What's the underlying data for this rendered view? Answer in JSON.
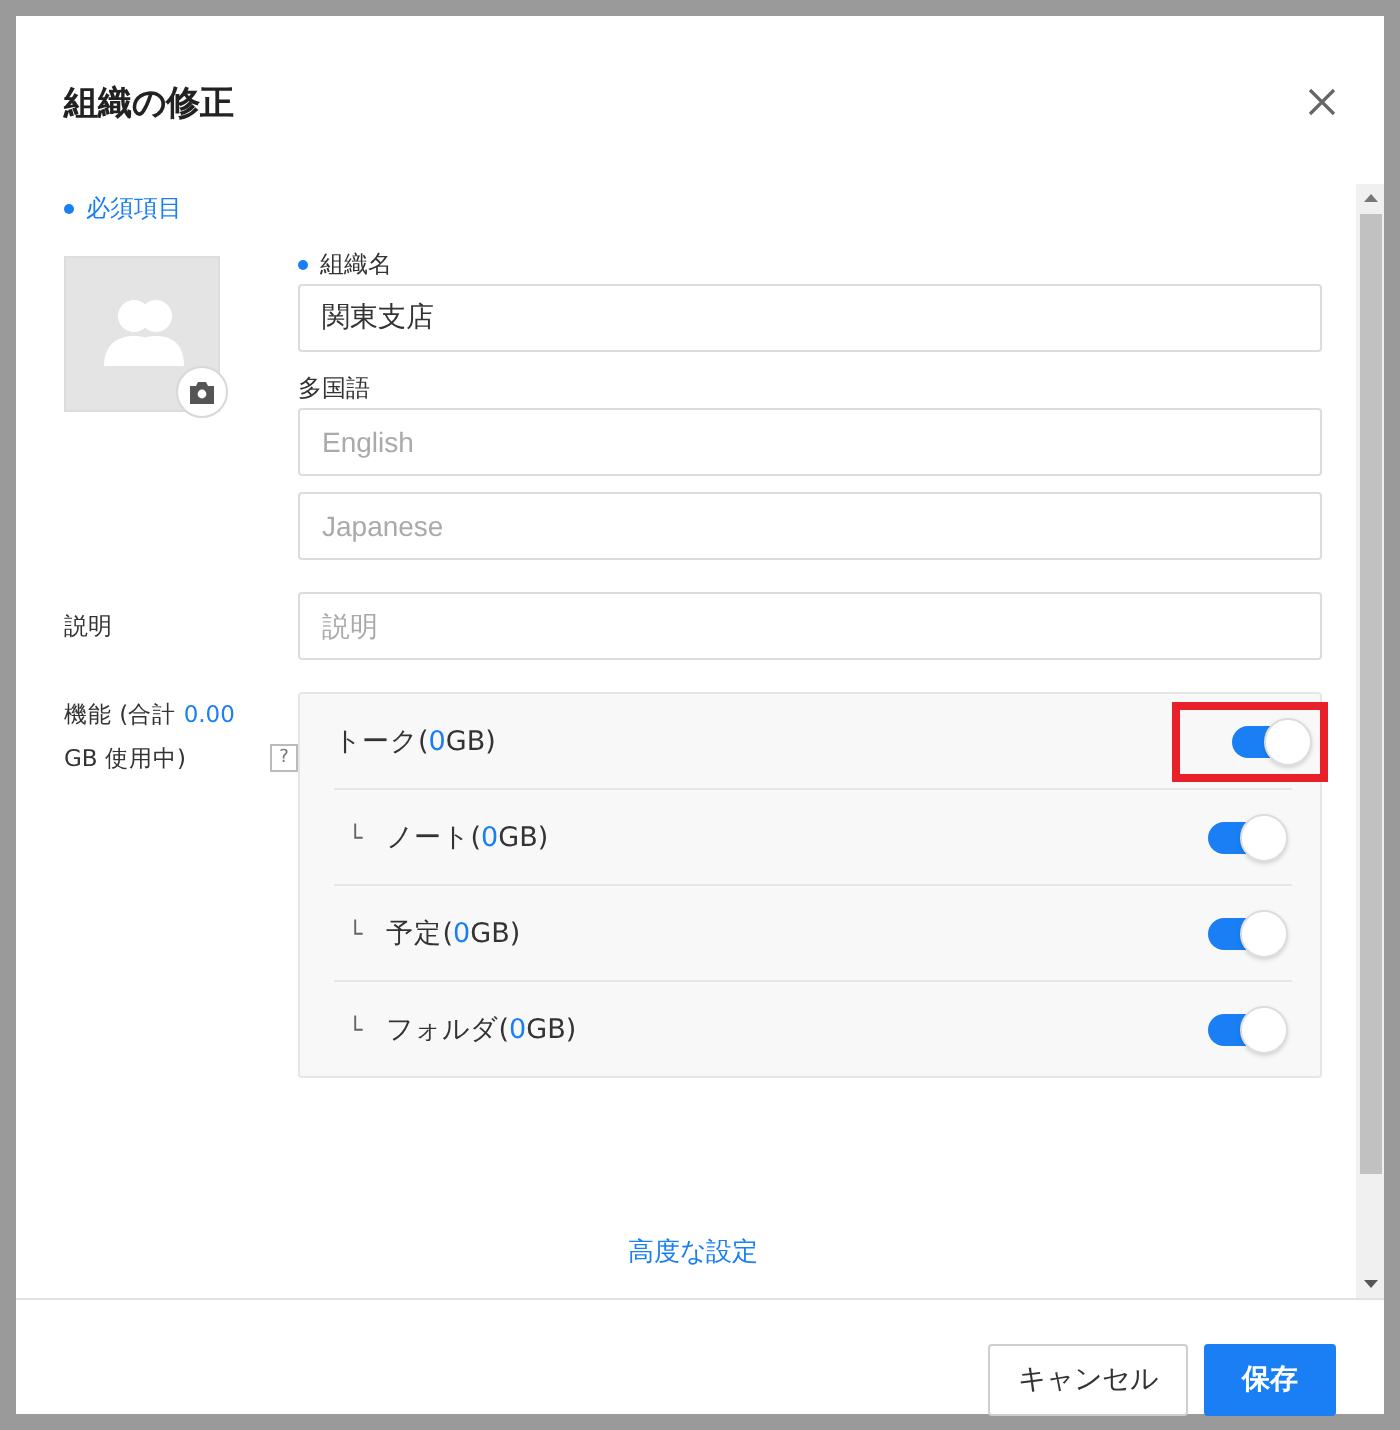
{
  "dialog": {
    "title": "組織の修正",
    "required_note": "必須項目",
    "org_name": {
      "label": "組織名",
      "value": "関東支店",
      "required": true
    },
    "multilingual": {
      "label": "多国語",
      "fields": [
        {
          "placeholder": "English"
        },
        {
          "placeholder": "Japanese"
        }
      ]
    },
    "description": {
      "label": "説明",
      "placeholder": "説明"
    },
    "features_label": {
      "before": "機能 (合計 ",
      "usage": "0.00",
      "after": " GB 使用中)",
      "help": "?"
    },
    "features": [
      {
        "before": "トーク(",
        "usage": "0",
        "after": "GB)",
        "on": true,
        "highlighted": true,
        "children": [
          {
            "branch": "└",
            "before": "ノート(",
            "usage": "0",
            "after": "GB)",
            "on": true,
            "highlighted": false
          },
          {
            "branch": "└",
            "before": "予定(",
            "usage": "0",
            "after": "GB)",
            "on": true,
            "highlighted": false
          },
          {
            "branch": "└",
            "before": "フォルダ(",
            "usage": "0",
            "after": "GB)",
            "on": true,
            "highlighted": false
          }
        ]
      }
    ],
    "advanced_link": "高度な設定",
    "buttons": [
      {
        "kind": "secondary",
        "label": "キャンセル"
      },
      {
        "kind": "primary",
        "label": "保存"
      }
    ]
  }
}
